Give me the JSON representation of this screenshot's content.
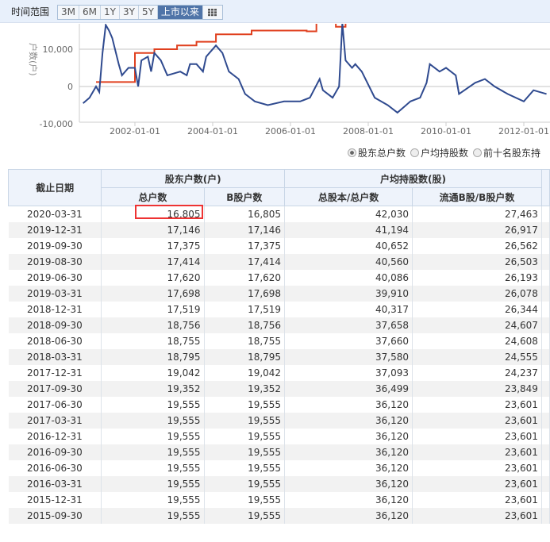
{
  "toolbar": {
    "label": "时间范围",
    "buttons": [
      "3M",
      "6M",
      "1Y",
      "3Y",
      "5Y",
      "上市以来"
    ],
    "active": "上市以来",
    "grid_icon": "grid-icon"
  },
  "chart_data": {
    "type": "line",
    "ylabel": "户数(户)",
    "ylim": [
      -10000,
      17000
    ],
    "yticks": [
      "10,000",
      "0",
      "-10,000"
    ],
    "ytick_values": [
      10000,
      0,
      -10000
    ],
    "xticks": [
      "2002-01-01",
      "2004-01-01",
      "2006-01-01",
      "2008-01-01",
      "2010-01-01",
      "2012-01-01"
    ],
    "grid": true,
    "series": [
      {
        "color": "#2f4a8f",
        "points": [
          [
            "2000-09",
            -4500
          ],
          [
            "2000-11",
            -3000
          ],
          [
            "2001-01",
            0
          ],
          [
            "2001-02",
            -1500
          ],
          [
            "2001-03",
            9000
          ],
          [
            "2001-04",
            16500
          ],
          [
            "2001-05",
            15000
          ],
          [
            "2001-06",
            13000
          ],
          [
            "2001-08",
            6000
          ],
          [
            "2001-09",
            3000
          ],
          [
            "2001-11",
            5000
          ],
          [
            "2002-01",
            5000
          ],
          [
            "2002-02",
            0
          ],
          [
            "2002-03",
            7000
          ],
          [
            "2002-05",
            8000
          ],
          [
            "2002-06",
            4000
          ],
          [
            "2002-07",
            9000
          ],
          [
            "2002-09",
            7000
          ],
          [
            "2002-11",
            3000
          ],
          [
            "2003-03",
            4000
          ],
          [
            "2003-05",
            3000
          ],
          [
            "2003-06",
            6000
          ],
          [
            "2003-08",
            6000
          ],
          [
            "2003-10",
            4000
          ],
          [
            "2003-11",
            8000
          ],
          [
            "2004-02",
            11000
          ],
          [
            "2004-04",
            9000
          ],
          [
            "2004-06",
            4000
          ],
          [
            "2004-09",
            2000
          ],
          [
            "2004-11",
            -2000
          ],
          [
            "2005-02",
            -4000
          ],
          [
            "2005-06",
            -5000
          ],
          [
            "2005-11",
            -4000
          ],
          [
            "2006-04",
            -4000
          ],
          [
            "2006-07",
            -3000
          ],
          [
            "2006-10",
            2000
          ],
          [
            "2006-11",
            -1000
          ],
          [
            "2007-02",
            -3000
          ],
          [
            "2007-04",
            0
          ],
          [
            "2007-05",
            17000
          ],
          [
            "2007-06",
            7000
          ],
          [
            "2007-08",
            5000
          ],
          [
            "2007-09",
            6000
          ],
          [
            "2007-11",
            4000
          ],
          [
            "2008-03",
            -3000
          ],
          [
            "2008-07",
            -5000
          ],
          [
            "2008-10",
            -7000
          ],
          [
            "2009-02",
            -4000
          ],
          [
            "2009-05",
            -3000
          ],
          [
            "2009-07",
            1000
          ],
          [
            "2009-08",
            6000
          ],
          [
            "2009-11",
            4000
          ],
          [
            "2010-01",
            5000
          ],
          [
            "2010-04",
            3000
          ],
          [
            "2010-05",
            -2000
          ],
          [
            "2010-10",
            1000
          ],
          [
            "2011-01",
            2000
          ],
          [
            "2011-04",
            0
          ],
          [
            "2011-08",
            -2000
          ],
          [
            "2012-01",
            -4000
          ],
          [
            "2012-04",
            -1000
          ],
          [
            "2012-08",
            -2000
          ]
        ]
      },
      {
        "color": "#e0401f",
        "points": [
          [
            "2001-01",
            1200
          ],
          [
            "2002-01",
            1200
          ],
          [
            "2002-01",
            9000
          ],
          [
            "2002-07",
            9000
          ],
          [
            "2002-07",
            10000
          ],
          [
            "2003-02",
            10000
          ],
          [
            "2003-02",
            11000
          ],
          [
            "2003-08",
            11000
          ],
          [
            "2003-08",
            12000
          ],
          [
            "2004-02",
            12000
          ],
          [
            "2004-02",
            14000
          ],
          [
            "2005-01",
            14000
          ],
          [
            "2005-01",
            15000
          ],
          [
            "2006-06",
            15000
          ],
          [
            "2006-06",
            14800
          ],
          [
            "2006-09",
            14800
          ],
          [
            "2006-09",
            18000
          ],
          [
            "2007-03",
            18000
          ],
          [
            "2007-03",
            16000
          ],
          [
            "2007-06",
            16000
          ],
          [
            "2007-06",
            18000
          ]
        ]
      }
    ]
  },
  "legend": [
    {
      "label": "股东总户数",
      "selected": true
    },
    {
      "label": "户均持股数",
      "selected": false
    },
    {
      "label": "前十名股东持",
      "selected": false
    }
  ],
  "table": {
    "group_headers": [
      "截止日期",
      "股东户数(户)",
      "户均持股数(股)"
    ],
    "sub_headers": [
      "总户数",
      "B股户数",
      "总股本/总户数",
      "流通B股/B股户数"
    ],
    "rows": [
      [
        "2020-03-31",
        "16,805",
        "16,805",
        "42,030",
        "27,463"
      ],
      [
        "2019-12-31",
        "17,146",
        "17,146",
        "41,194",
        "26,917"
      ],
      [
        "2019-09-30",
        "17,375",
        "17,375",
        "40,652",
        "26,562"
      ],
      [
        "2019-08-30",
        "17,414",
        "17,414",
        "40,560",
        "26,503"
      ],
      [
        "2019-06-30",
        "17,620",
        "17,620",
        "40,086",
        "26,193"
      ],
      [
        "2019-03-31",
        "17,698",
        "17,698",
        "39,910",
        "26,078"
      ],
      [
        "2018-12-31",
        "17,519",
        "17,519",
        "40,317",
        "26,344"
      ],
      [
        "2018-09-30",
        "18,756",
        "18,756",
        "37,658",
        "24,607"
      ],
      [
        "2018-06-30",
        "18,755",
        "18,755",
        "37,660",
        "24,608"
      ],
      [
        "2018-03-31",
        "18,795",
        "18,795",
        "37,580",
        "24,555"
      ],
      [
        "2017-12-31",
        "19,042",
        "19,042",
        "37,093",
        "24,237"
      ],
      [
        "2017-09-30",
        "19,352",
        "19,352",
        "36,499",
        "23,849"
      ],
      [
        "2017-06-30",
        "19,555",
        "19,555",
        "36,120",
        "23,601"
      ],
      [
        "2017-03-31",
        "19,555",
        "19,555",
        "36,120",
        "23,601"
      ],
      [
        "2016-12-31",
        "19,555",
        "19,555",
        "36,120",
        "23,601"
      ],
      [
        "2016-09-30",
        "19,555",
        "19,555",
        "36,120",
        "23,601"
      ],
      [
        "2016-06-30",
        "19,555",
        "19,555",
        "36,120",
        "23,601"
      ],
      [
        "2016-03-31",
        "19,555",
        "19,555",
        "36,120",
        "23,601"
      ],
      [
        "2015-12-31",
        "19,555",
        "19,555",
        "36,120",
        "23,601"
      ],
      [
        "2015-09-30",
        "19,555",
        "19,555",
        "36,120",
        "23,601"
      ]
    ]
  }
}
